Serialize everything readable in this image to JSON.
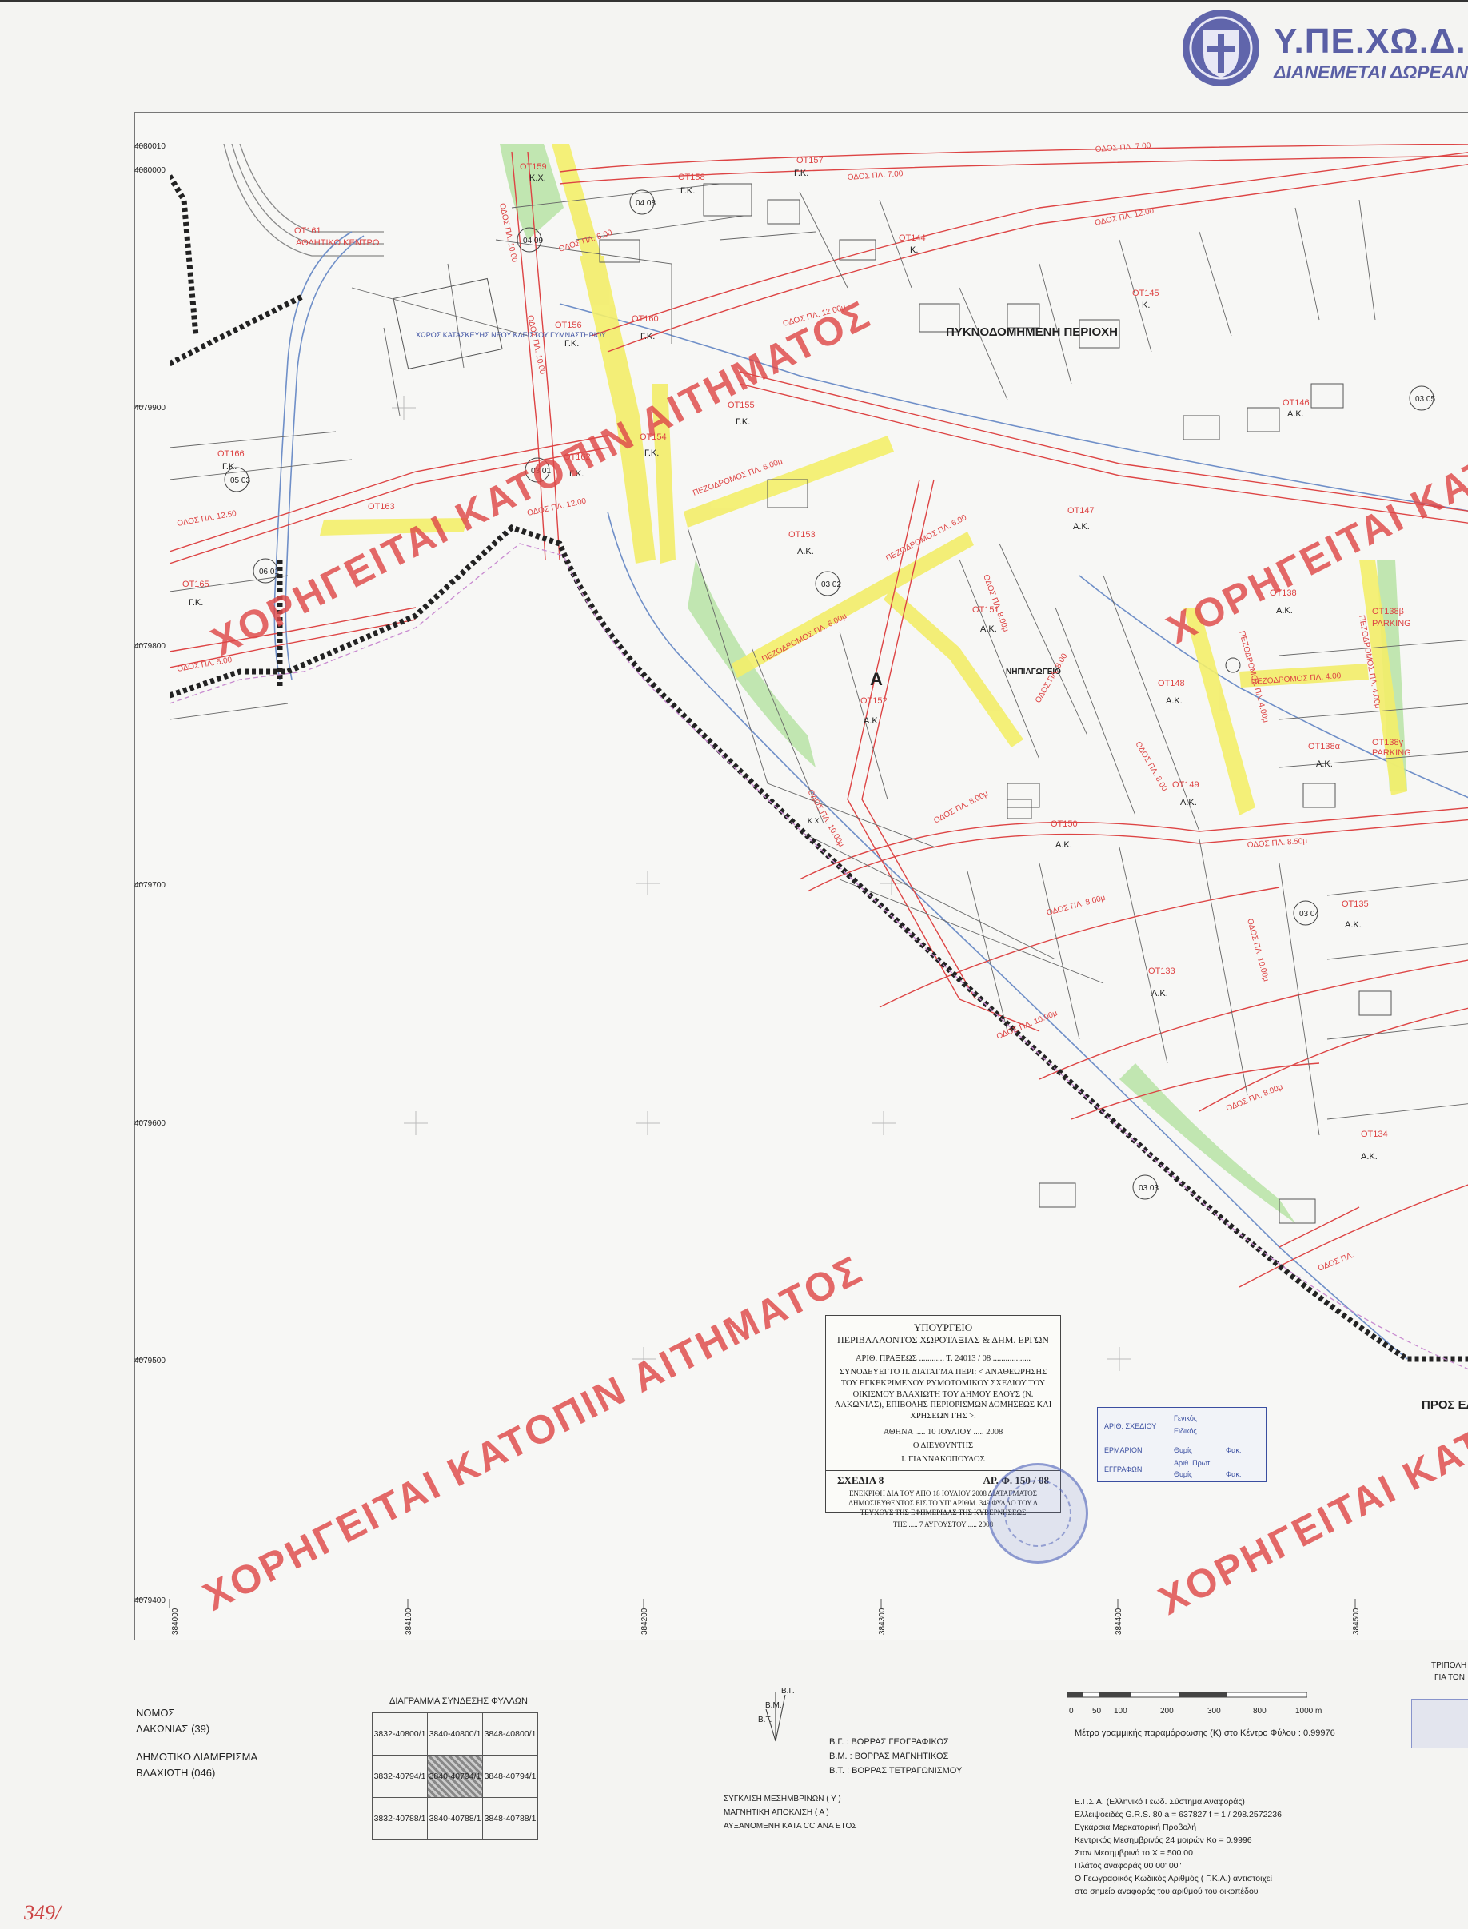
{
  "brand": {
    "name": "Υ.ΠΕ.ΧΩ.Δ.Ε.",
    "subtitle": "ΔΙΑΝΕΜΕΤΑΙ ΔΩΡΕΑΝ",
    "emblem": "greek-cross-emblem-icon"
  },
  "watermarks": [
    "ΧΟΡΗΓΕΙΤΑΙ ΚΑΤΟΠΙΝ ΑΙΤΗΜΑΤΟΣ",
    "ΧΟΡΗΓΕΙΤΑΙ ΚΑΤΟΠΙΝ ΑΙΤΗΜΑΤΟΣ",
    "ΧΟΡΗΓΕΙΤΑΙ ΚΑΤΟΠΙΝ ΑΙΤΗΜΑΤΟΣ",
    "ΧΟΡΗΓΕΙΤΑΙ ΚΑΤΟΠΙΝ ΑΙΤΗΜΑΤΟΣ",
    "ΧΟΡΗΓΕΙΤΑΙ ΚΑΤΟ"
  ],
  "map": {
    "y_ticks": [
      "4080010",
      "4080000",
      "4079900",
      "4079800",
      "4079700",
      "4079600",
      "4079500",
      "4079400"
    ],
    "x_ticks": [
      "384000",
      "384100",
      "384200",
      "384300",
      "384400",
      "384500"
    ],
    "area_label": "ΠΥΚΝΟΔΟΜΗΜΕΝΗ ΠΕΡΙΟΧΗ",
    "zone_letter": "A",
    "to_elos": "ΠΡΟΣ ΕΛΟΣ",
    "labels": {
      "ot161": "ΟΤ161",
      "ot161b": "ΑΘΛΗΤΙΚΟ ΚΕΝΤΡΟ",
      "gym": "ΧΩΡΟΣ ΚΑΤΑΣΚΕΥΗΣ ΝΕΟΥ ΚΛΕΙΣΤΟΥ ΓΥΜΝΑΣΤΗΡΙΟΥ",
      "ot159": "ΟΤ159",
      "ot159b": "Κ.Χ.",
      "ot158": "ΟΤ158",
      "ot158b": "Γ.Κ.",
      "ot157": "ΟΤ157",
      "ot157b": "Γ.Κ.",
      "ot144": "ΟΤ144",
      "ot144b": "Κ.",
      "ot145": "ΟΤ145",
      "ot145b": "Κ.",
      "ot156": "ΟΤ156",
      "ot156b": "Γ.Κ.",
      "ot155": "ΟΤ155",
      "ot155b": "Γ.Κ.",
      "ot160": "ΟΤ160",
      "ot160b": "Γ.Κ.",
      "ot162": "ΟΤ162",
      "ot162b": "Γ.Κ.",
      "ot166": "ΟΤ166",
      "ot166b": "Γ.Κ.",
      "ot163": "ΟΤ163",
      "ot165": "ΟΤ165",
      "ot165b": "Γ.Κ.",
      "ot153": "ΟΤ153",
      "ot153b": "Α.Κ.",
      "ot154": "ΟΤ154",
      "ot154b": "Γ.Κ.",
      "ot151": "ΟΤ151",
      "ot151b": "Α.Κ.",
      "ot152": "ΟΤ152",
      "ot152b": "Α.Κ.",
      "ot147": "ΟΤ147",
      "ot147b": "Α.Κ.",
      "ot146": "ΟΤ146",
      "ot146b": "Α.Κ.",
      "ot148": "ΟΤ148",
      "ot148b": "Α.Κ.",
      "ot149": "ΟΤ149",
      "ot149b": "Α.Κ.",
      "ot150": "ΟΤ150",
      "ot150b": "Α.Κ.",
      "ot138": "ΟΤ138",
      "ot138b": "Α.Κ.",
      "ot138a": "ΟΤ138α",
      "ot138ab": "Α.Κ.",
      "ot138b2": "ΟΤ138β",
      "ot138bparking": "PARKING",
      "ot138g": "ΟΤ138γ",
      "ot138gparking": "PARKING",
      "ot135": "ΟΤ135",
      "ot135b": "Α.Κ.",
      "ot133": "ΟΤ133",
      "ot133b": "Α.Κ.",
      "ot134": "ΟΤ134",
      "ot134b": "Α.Κ.",
      "nipiagogeio": "ΝΗΠΙΑΓΩΓΕΙΟ",
      "kx": "Κ.Χ."
    },
    "roads": {
      "r1": "ΟΔΟΣ ΠΛ. 7.00",
      "r2": "ΟΔΟΣ ΠΛ. 7.00",
      "r3": "ΟΔΟΣ ΠΛ. 12.00",
      "r4": "ΟΔΟΣ ΠΛ. 12.00μ",
      "r5": "ΟΔΟΣ ΠΛ. 8.00",
      "r6": "ΟΔΟΣ ΠΛ. 10.00",
      "r7": "ΟΔΟΣ ΠΛ. 10.00",
      "r8": "ΟΔΟΣ ΠΛ. 12.00",
      "r9": "ΟΔΟΣ ΠΛ. 12.50",
      "r10": "ΟΔΟΣ ΠΛ. 5.00",
      "r11": "ΠΕΖΟΔΡΟΜΟΣ ΠΛ. 6.00μ",
      "r12": "ΠΕΖΟΔΡΟΜΟΣ ΠΛ. 6.00μ",
      "r13": "ΠΕΖΟΔΡΟΜΟΣ ΠΛ. 6.00",
      "r14": "ΠΕΖΟΔΡΟΜΟΣ ΠΛ. 4.00",
      "r15": "ΟΔΟΣ ΠΛ. 10.00μ",
      "r16": "ΟΔΟΣ ΠΛ. 8.00μ",
      "r17": "ΟΔΟΣ ΠΛ. 8.50μ",
      "r18": "ΟΔΟΣ ΠΛ. 8.00",
      "r19": "ΟΔΟΣ ΠΛ. 8.00μ",
      "r20": "ΟΔΟΣ ΠΛ. 10.00μ",
      "r21": "ΟΔΟΣ ΠΛ. 8.00μ",
      "r22": "ΟΔΟΣ ΠΛ. 8.00",
      "r23": "ΟΔΟΣ ΠΛ. 10.00μ",
      "r24": "ΠΕΖΟΔΡΟΜΟΣ ΠΛ. 4.00μ",
      "r25": "ΠΕΖΟΔΡΟΜΟΣ ΠΛ. 4.00μ",
      "r26": "ΟΔΟΣ ΠΛ. 8.00μ",
      "r27": "ΟΔΟΣ ΠΛ."
    },
    "sheets": [
      "03 01",
      "03 02",
      "03 03",
      "03 04",
      "03 05",
      "04 08",
      "04 09",
      "05 03",
      "06 01"
    ]
  },
  "decree": {
    "l1": "ΥΠΟΥΡΓΕΙΟ",
    "l2": "ΠΕΡΙΒΑΛΛΟΝΤΟΣ ΧΩΡΟΤΑΞΙΑΣ & ΔΗΜ. ΕΡΓΩΝ",
    "l3": "ΑΡΙΘ. ΠΡΑΞΕΩΣ ............ Τ. 24013 / 08 ..................",
    "l4": "ΣΥΝΟΔΕΥΕΙ ΤΟ Π. ΔΙΑΤΑΓΜΑ ΠΕΡΙ: < ΑΝΑΘΕΩΡΗΣΗΣ ΤΟΥ ΕΓΚΕΚΡΙΜΕΝΟΥ ΡΥΜΟΤΟΜΙΚΟΥ ΣΧΕΔΙΟΥ ΤΟΥ ΟΙΚΙΣΜΟΥ ΒΛΑΧΙΩΤΗ ΤΟΥ ΔΗΜΟΥ ΕΛΟΥΣ (Ν. ΛΑΚΩΝΙΑΣ), ΕΠΙΒΟΛΗΣ ΠΕΡΙΟΡΙΣΜΩΝ ΔΟΜΗΣΕΩΣ ΚΑΙ ΧΡΗΣΕΩΝ ΓΗΣ >.",
    "l5": "ΑΘΗΝΑ ..... 10 ΙΟΥΛΙΟΥ ..... 2008",
    "l6": "Ο ΔΙΕΥΘΥΝΤΗΣ",
    "l7": "Ι. ΓΙΑΝΝΑΚΟΠΟΥΛΟΣ",
    "sheet": "ΣΧΕΔΙΑ 8",
    "number": "ΑΡ. Φ. 150 / 08",
    "l8": "ΕΝΕΚΡΙΘΗ ΔΙΑ ΤΟΥ ΑΠΟ 18 ΙΟΥΛΙΟΥ 2008 ΔΙΑΤΑΓΜΑΤΟΣ ΔΗΜΟΣΙΕΥΘΕΝΤΟΣ ΕΙΣ ΤΟ ΥΠ' ΑΡΙΘΜ. 349 ΦΥΛΛΟ ΤΟΥ Δ ΤΕΥΧΟΥΣ ΤΗΣ ΕΦΗΜΕΡΙΔΑΣ ΤΗΣ ΚΥΒΕΡΝΗΣΕΩΣ",
    "l9": "ΤΗΣ ..... 7 ΑΥΓΟΥΣΤΟΥ ..... 2008"
  },
  "stamp": {
    "r1": "ΑΡΙΘ. ΣΧΕΔΙΟΥ",
    "r1v1": "Γενικός",
    "r1v2": "Ειδικός",
    "r2": "ΕΡΜΑΡΙΟΝ",
    "r2v1": "Θυρίς",
    "r2v2": "Φακ.",
    "r3": "ΕΓΓΡΑΦΩΝ",
    "r3v1": "Αριθ. Πρωτ.",
    "r3v2": "Θυρίς",
    "r3v3": "Φακ."
  },
  "legend": {
    "nomos_label": "ΝΟΜΟΣ",
    "nomos": "ΛΑΚΩΝΙΑΣ (39)",
    "dd_label": "ΔΗΜΟΤΙΚΟ ΔΙΑΜΕΡΙΣΜΑ",
    "dd": "ΒΛΑΧΙΩΤΗ (046)",
    "grid_title": "ΔΙΑΓΡΑΜΜΑ ΣΥΝΔΕΣΗΣ ΦΥΛΛΩΝ",
    "grid": [
      [
        "3832-40800/1",
        "3840-40800/1",
        "3848-40800/1"
      ],
      [
        "3832-40794/1",
        "3840-40794/1",
        "3848-40794/1"
      ],
      [
        "3832-40788/1",
        "3840-40788/1",
        "3848-40788/1"
      ]
    ],
    "north_labels": [
      "Β.Γ.",
      "Β.Μ.",
      "Β.Τ."
    ],
    "north_desc": [
      "Β.Γ. : ΒΟΡΡΑΣ ΓΕΩΓΡΑΦΙΚΟΣ",
      "Β.Μ. : ΒΟΡΡΑΣ ΜΑΓΝΗΤΙΚΟΣ",
      "Β.Τ. : ΒΟΡΡΑΣ ΤΕΤΡΑΓΩΝΙΣΜΟΥ"
    ],
    "conv": [
      "ΣΥΓΚΛΙΣΗ ΜΕΣΗΜΒΡΙΝΩΝ ( Υ )",
      "ΜΑΓΝΗΤΙΚΗ ΑΠΟΚΛΙΣΗ ( Α )",
      "ΑΥΞΑΝΟΜΕΝΗ ΚΑΤΑ      CC ΑΝΑ ΕΤΟΣ"
    ],
    "scale_ticks": [
      "0",
      "50",
      "100",
      "200",
      "300",
      "800",
      "1000 m"
    ],
    "scale_note": "Μέτρο γραμμικής παραμόρφωσης (Κ) στο Κέντρο Φύλου : 0.99976",
    "ref": [
      "Ε.Γ.Σ.Α. (Ελληνικό Γεωδ. Σύστημα Αναφοράς)",
      "Ελλειψοειδές G.R.S. 80  a = 637827  f = 1 / 298.2572236",
      "Εγκάρσια Μερκατορική Προβολή",
      "Κεντρικός Μεσημβρινός 24 μοιρών Ko = 0.9996",
      "Στον Μεσημβρινό το Χ = 500.00",
      "Πλάτος αναφοράς 00  00' 00''",
      "Ο Γεωγραφικός Κωδικός Αριθμός ( Γ.Κ.Α.) αντιστοιχεί",
      "στο σημείο αναφοράς του αριθμού του οικοπέδου"
    ],
    "right_cut": [
      "ΤΡΙΠΟΛΗ",
      "ΓΙΑ ΤΟΝ"
    ],
    "corner": "349/"
  },
  "colors": {
    "brand": "#5a5fa5",
    "watermark": "#de4848",
    "road_yellow": "#f3ee6a",
    "green": "#b7e3a5",
    "red_line": "#d44",
    "stamp_blue": "#3a4ea0"
  }
}
